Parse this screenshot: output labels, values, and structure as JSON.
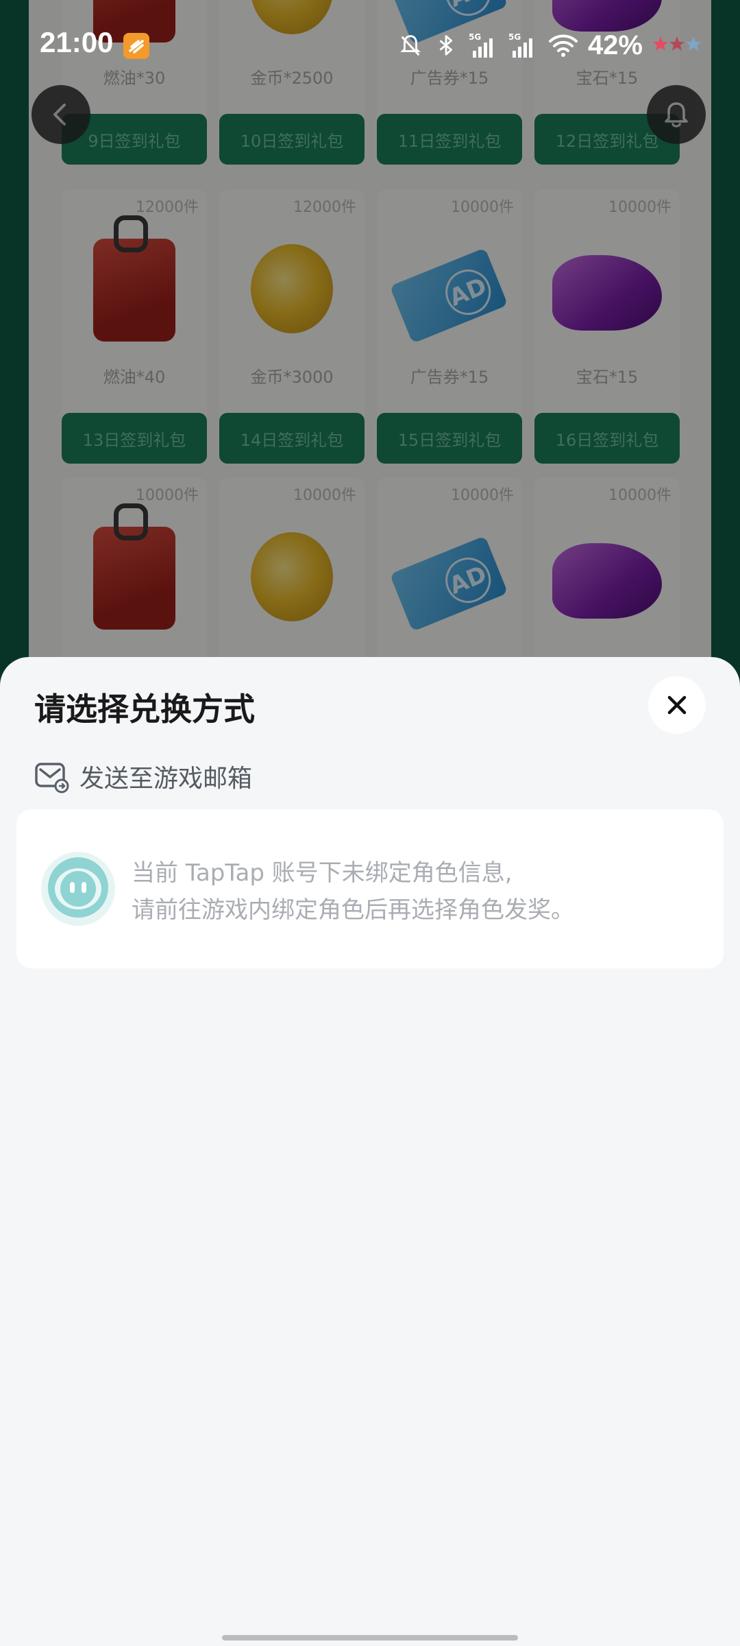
{
  "status_bar": {
    "time": "21:00",
    "battery": "42%",
    "icons": [
      "app-badge-icon",
      "mute-bell-icon",
      "bluetooth-icon",
      "5g-signal-icon",
      "5g-signal-icon",
      "wifi-icon",
      "rating-stars-icon"
    ]
  },
  "background": {
    "rows": [
      {
        "cards": [
          {
            "count": "",
            "name": "燃油*30",
            "claim": "9日签到礼包",
            "item": "fuel"
          },
          {
            "count": "",
            "name": "金币*2500",
            "claim": "10日签到礼包",
            "item": "coin"
          },
          {
            "count": "",
            "name": "广告券*15",
            "claim": "11日签到礼包",
            "item": "ad"
          },
          {
            "count": "",
            "name": "宝石*15",
            "claim": "12日签到礼包",
            "item": "gem"
          }
        ]
      },
      {
        "cards": [
          {
            "count": "12000件",
            "name": "燃油*40",
            "claim": "13日签到礼包",
            "item": "fuel"
          },
          {
            "count": "12000件",
            "name": "金币*3000",
            "claim": "14日签到礼包",
            "item": "coin"
          },
          {
            "count": "10000件",
            "name": "广告券*15",
            "claim": "15日签到礼包",
            "item": "ad"
          },
          {
            "count": "10000件",
            "name": "宝石*15",
            "claim": "16日签到礼包",
            "item": "gem"
          }
        ]
      },
      {
        "cards": [
          {
            "count": "10000件",
            "name": "",
            "claim": "",
            "item": "fuel"
          },
          {
            "count": "10000件",
            "name": "",
            "claim": "",
            "item": "coin"
          },
          {
            "count": "10000件",
            "name": "",
            "claim": "",
            "item": "ad"
          },
          {
            "count": "10000件",
            "name": "",
            "claim": "",
            "item": "gem"
          }
        ]
      }
    ]
  },
  "sheet": {
    "title": "请选择兑换方式",
    "method_label": "发送至游戏邮箱",
    "info_line1": "当前 TapTap 账号下未绑定角色信息,",
    "info_line2": "请前往游戏内绑定角色后再选择角色发奖。"
  },
  "colors": {
    "accent_green": "#1b7d58",
    "sheet_bg": "#f5f6f8",
    "avatar_teal": "#8fd3d3"
  }
}
